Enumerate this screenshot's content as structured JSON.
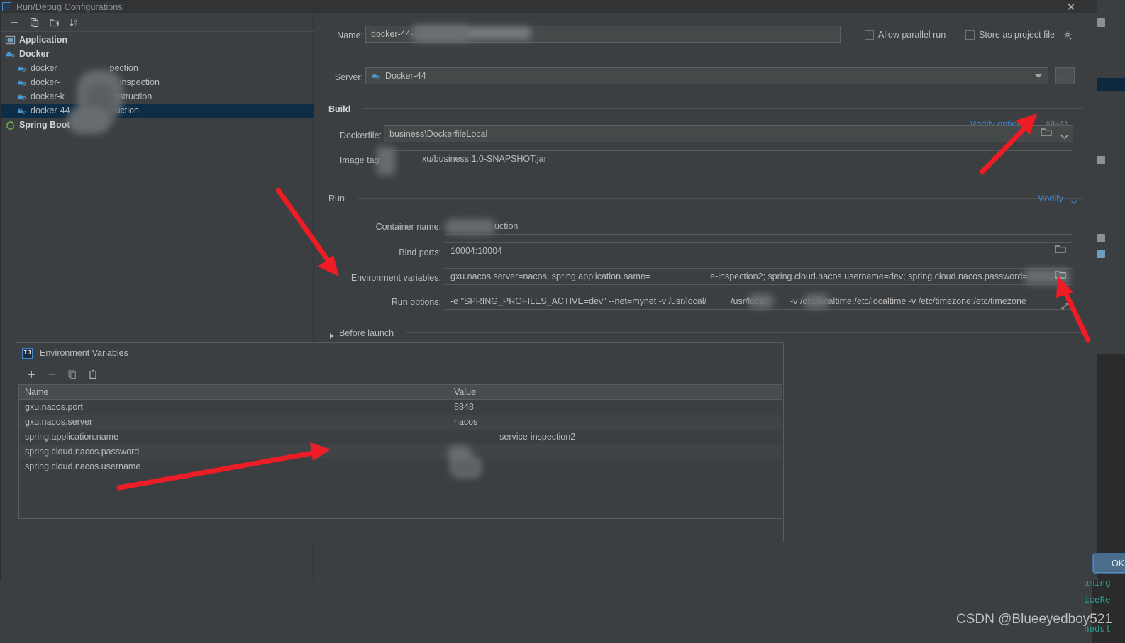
{
  "window": {
    "title": "Run/Debug Configurations",
    "close_label": "✕"
  },
  "left_panel": {
    "toolbar": [
      {
        "name": "remove-button",
        "glyph": "minus"
      },
      {
        "name": "copy-button",
        "glyph": "copy"
      },
      {
        "name": "new-folder-button",
        "glyph": "folder-plus"
      },
      {
        "name": "sort-button",
        "glyph": "sort-az"
      }
    ],
    "tree": [
      {
        "label": "Application",
        "level": "group",
        "icon": "application-icon",
        "selected": false
      },
      {
        "label": "Docker",
        "level": "group",
        "icon": "docker-icon",
        "selected": false
      },
      {
        "label": "docker",
        "suffix": "pection",
        "level": "child",
        "icon": "docker-icon",
        "selected": false
      },
      {
        "label": "docker-",
        "suffix": "inspection",
        "level": "child",
        "icon": "docker-icon",
        "selected": false
      },
      {
        "label": "docker-k",
        "suffix": "construction",
        "level": "child",
        "icon": "docker-icon",
        "selected": false
      },
      {
        "label": "docker-44-",
        "suffix": "struction",
        "level": "child",
        "icon": "docker-icon",
        "selected": true
      },
      {
        "label": "Spring Boot",
        "level": "group",
        "icon": "spring-icon",
        "selected": false
      }
    ]
  },
  "form": {
    "name_label": "Name:",
    "name_value": "docker-44-",
    "server_label": "Server:",
    "server_value": "Docker-44",
    "server_icon": "docker-icon",
    "browse_label": "...",
    "allow_parallel_run": "Allow parallel run",
    "store_as_project_file": "Store as project file",
    "gear_icon": "gear-icon",
    "build_section": "Build",
    "modify_options_link": "Modify options",
    "modify_options_shortcut": "Alt+M",
    "dockerfile_label": "Dockerfile:",
    "dockerfile_value": "business\\DockerfileLocal",
    "image_tag_label": "Image tag:",
    "image_tag_value": "xu/business:1.0-SNAPSHOT.jar",
    "run_section": "Run",
    "modify_link": "Modify",
    "container_name_label": "Container name:",
    "container_name_value": "uction",
    "bind_ports_label": "Bind ports:",
    "bind_ports_value": "10004:10004",
    "env_vars_label": "Environment variables:",
    "env_vars_value_a": "gxu.nacos.server=nacos; spring.application.name=",
    "env_vars_value_b": "e-inspection2; spring.cloud.nacos.username=dev; spring.cloud.nacos.password=",
    "run_options_label": "Run options:",
    "run_options_value_a": "-e \"SPRING_PROFILES_ACTIVE=dev\" --net=mynet -v /usr/local/",
    "run_options_value_b": "/usr/local",
    "run_options_value_c": "-v /etc/localtime:/etc/localtime  -v /etc/timezone:/etc/timezone",
    "before_launch_label": "Before launch"
  },
  "env_dialog": {
    "title": "Environment Variables",
    "icon": "intellij-idea-icon",
    "toolbar": [
      {
        "name": "add-button",
        "glyph": "plus"
      },
      {
        "name": "remove-button",
        "glyph": "minus"
      },
      {
        "name": "copy-button",
        "glyph": "copy"
      },
      {
        "name": "paste-button",
        "glyph": "paste"
      }
    ],
    "columns": [
      "Name",
      "Value"
    ],
    "rows": [
      {
        "name": "gxu.nacos.port",
        "value": "8848"
      },
      {
        "name": "gxu.nacos.server",
        "value": "nacos"
      },
      {
        "name": "spring.application.name",
        "value": "-service-inspection2"
      },
      {
        "name": "spring.cloud.nacos.password",
        "value": ""
      },
      {
        "name": "spring.cloud.nacos.username",
        "value": "dev"
      }
    ]
  },
  "buttons": {
    "ok": "OK"
  },
  "background": {
    "code_fragments": [
      "aming",
      "iceRe",
      "hedul"
    ]
  },
  "watermark": "CSDN @Blueeyedboy521",
  "colors": {
    "window_bg": "#3c3f41",
    "titlebar_bg": "#313335",
    "field_bg": "#45494a",
    "selection_blue": "#0d2d47",
    "link_blue": "#3f87d6",
    "accent_red": "#ee1c25",
    "code_teal": "#2aa198",
    "ok_button": "#4a6d8c"
  }
}
